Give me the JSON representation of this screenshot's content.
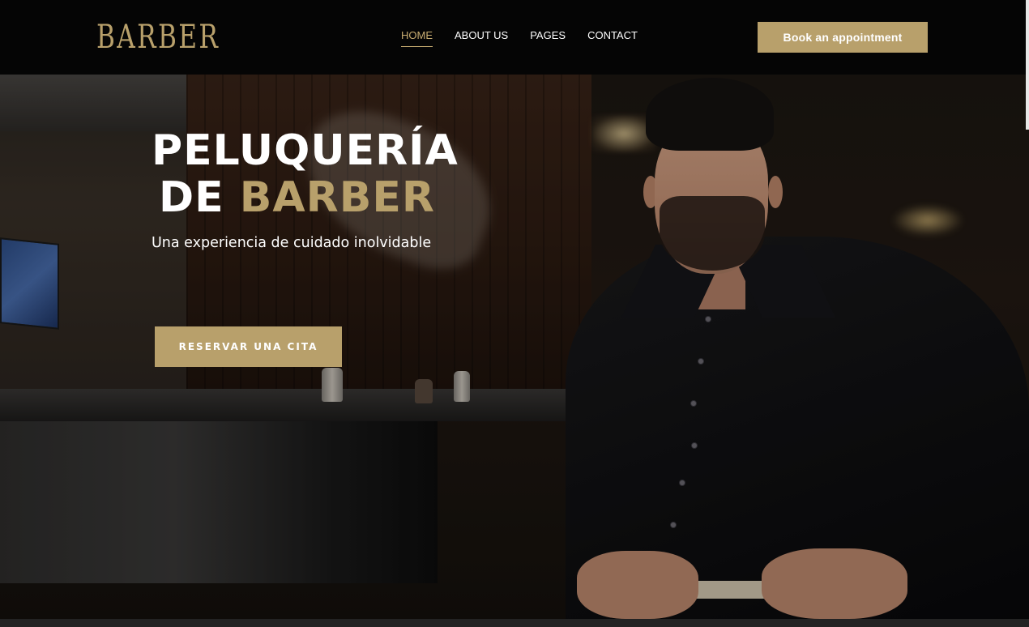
{
  "header": {
    "logo": "BARBER",
    "nav": [
      {
        "label": "HOME",
        "active": true
      },
      {
        "label": "ABOUT US",
        "active": false
      },
      {
        "label": "PAGES",
        "active": false
      },
      {
        "label": "CONTACT",
        "active": false
      }
    ],
    "cta_label": "Book an appointment"
  },
  "hero": {
    "title_line1": "PELUQUERÍA",
    "title_line2_white": "DE ",
    "title_line2_gold": "BARBER",
    "subtitle": "Una experiencia de cuidado inolvidable",
    "button_label": "RESERVAR UNA CITA"
  },
  "colors": {
    "accent": "#b8a06b",
    "accent_nav": "#c9ad72",
    "header_bg": "#050505",
    "text": "#ffffff"
  },
  "icons": [
    "logo-wordmark"
  ]
}
